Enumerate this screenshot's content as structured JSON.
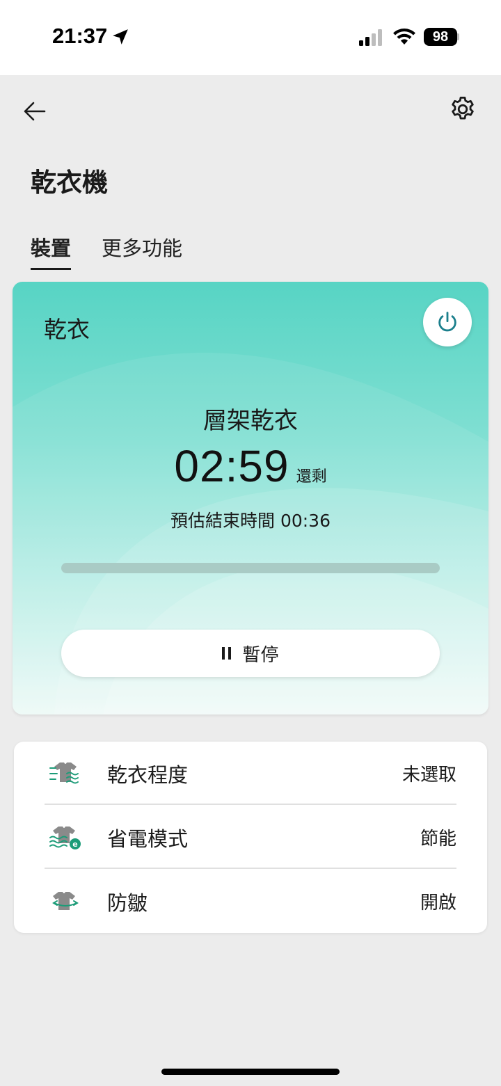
{
  "status_bar": {
    "time": "21:37",
    "battery": "98",
    "icons": [
      "location-arrow-icon",
      "cellular-signal-icon",
      "wifi-icon",
      "battery-icon"
    ]
  },
  "header": {
    "back_icon": "arrow-left-icon",
    "settings_icon": "gear-icon",
    "title": "乾衣機"
  },
  "tabs": [
    {
      "label": "裝置",
      "active": true
    },
    {
      "label": "更多功能",
      "active": false
    }
  ],
  "status_card": {
    "mode_label": "乾衣",
    "power_icon": "power-icon",
    "cycle_name": "層架乾衣",
    "time_remaining": "02:59",
    "remaining_label": "還剩",
    "end_time": "預估結束時間 00:36",
    "progress": 0.0,
    "pause_label": "暫停",
    "colors": {
      "gradient_top": "#57d4c4",
      "gradient_bottom": "#eefaf7",
      "accent": "#1b7f8c"
    }
  },
  "options": [
    {
      "icon": "dryness-level-icon",
      "label": "乾衣程度",
      "value": "未選取"
    },
    {
      "icon": "eco-mode-icon",
      "label": "省電模式",
      "value": "節能"
    },
    {
      "icon": "anti-wrinkle-icon",
      "label": "防皺",
      "value": "開啟"
    }
  ]
}
